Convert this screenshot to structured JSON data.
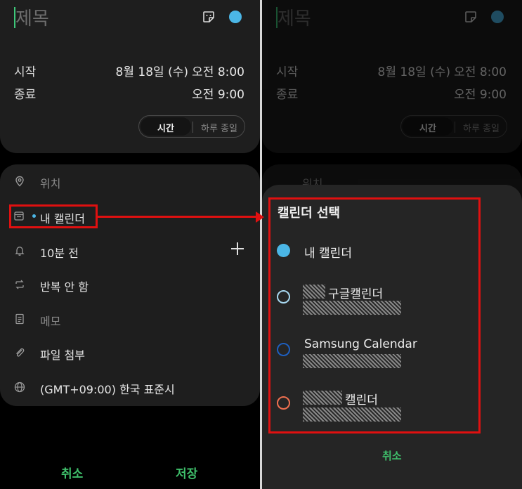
{
  "event": {
    "title_placeholder": "제목",
    "start_label": "시작",
    "start_date": "8월 18일 (수)",
    "start_time": "오전 8:00",
    "end_label": "종료",
    "end_time": "오전 9:00",
    "toggle_time": "시간",
    "toggle_allday": "하루 종일",
    "accent_color": "#4bb6e6"
  },
  "details": {
    "location": "위치",
    "calendar": "내 캘린더",
    "reminder": "10분 전",
    "repeat": "반복 안 함",
    "memo": "메모",
    "attachment": "파일 첨부",
    "timezone": "(GMT+09:00) 한국 표준시"
  },
  "actions": {
    "cancel": "취소",
    "save": "저장"
  },
  "calendar_sheet": {
    "title": "캘린더 선택",
    "options": [
      {
        "label": "내 캘린더",
        "color": "#4bb6e6",
        "selected": true
      },
      {
        "label": "구글캘린더",
        "color": "#a8d8f0",
        "selected": false
      },
      {
        "label": "Samsung Calendar",
        "color": "#1e5fbf",
        "selected": false
      },
      {
        "label": "캘린더",
        "color": "#f07050",
        "selected": false
      }
    ],
    "cancel": "취소"
  }
}
